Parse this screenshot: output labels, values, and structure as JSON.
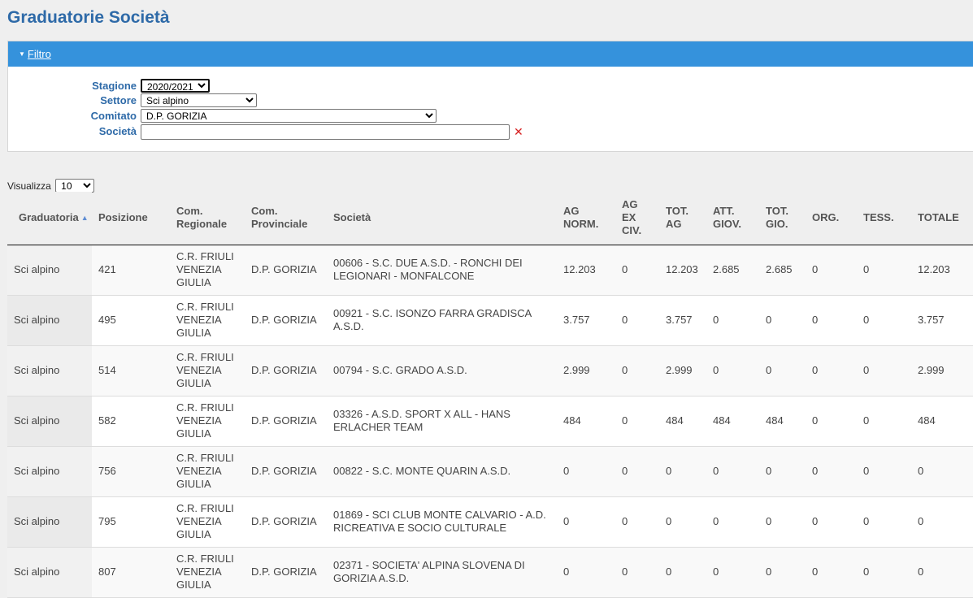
{
  "page": {
    "title": "Graduatorie Società"
  },
  "filter": {
    "toggle_label": "Filtro",
    "season": {
      "label": "Stagione",
      "value": "2020/2021"
    },
    "sector": {
      "label": "Settore",
      "value": "Sci alpino"
    },
    "committee": {
      "label": "Comitato",
      "value": "D.P. GORIZIA"
    },
    "society": {
      "label": "Società",
      "value": ""
    }
  },
  "show": {
    "label": "Visualizza",
    "value": "10"
  },
  "table": {
    "sort_column": "Graduatoria",
    "sort_direction": "asc",
    "headers": [
      [
        "Graduatoria"
      ],
      [
        "Posizione"
      ],
      [
        "Com.",
        "Regionale"
      ],
      [
        "Com.",
        "Provinciale"
      ],
      [
        "Società"
      ],
      [
        "AG",
        "NORM."
      ],
      [
        "AG",
        "EX",
        "CIV."
      ],
      [
        "TOT.",
        "AG"
      ],
      [
        "ATT.",
        "GIOV."
      ],
      [
        "TOT.",
        "GIO."
      ],
      [
        "ORG."
      ],
      [
        "TESS."
      ],
      [
        "TOTALE"
      ]
    ],
    "rows": [
      [
        "Sci alpino",
        "421",
        "C.R. FRIULI VENEZIA GIULIA",
        "D.P. GORIZIA",
        "00606 - S.C. DUE A.S.D. - RONCHI DEI LEGIONARI - MONFALCONE",
        "12.203",
        "0",
        "12.203",
        "2.685",
        "2.685",
        "0",
        "0",
        "12.203"
      ],
      [
        "Sci alpino",
        "495",
        "C.R. FRIULI VENEZIA GIULIA",
        "D.P. GORIZIA",
        "00921 - S.C. ISONZO FARRA GRADISCA A.S.D.",
        "3.757",
        "0",
        "3.757",
        "0",
        "0",
        "0",
        "0",
        "3.757"
      ],
      [
        "Sci alpino",
        "514",
        "C.R. FRIULI VENEZIA GIULIA",
        "D.P. GORIZIA",
        "00794 - S.C. GRADO A.S.D.",
        "2.999",
        "0",
        "2.999",
        "0",
        "0",
        "0",
        "0",
        "2.999"
      ],
      [
        "Sci alpino",
        "582",
        "C.R. FRIULI VENEZIA GIULIA",
        "D.P. GORIZIA",
        "03326 - A.S.D. SPORT X ALL - HANS ERLACHER TEAM",
        "484",
        "0",
        "484",
        "484",
        "484",
        "0",
        "0",
        "484"
      ],
      [
        "Sci alpino",
        "756",
        "C.R. FRIULI VENEZIA GIULIA",
        "D.P. GORIZIA",
        "00822 - S.C. MONTE QUARIN A.S.D.",
        "0",
        "0",
        "0",
        "0",
        "0",
        "0",
        "0",
        "0"
      ],
      [
        "Sci alpino",
        "795",
        "C.R. FRIULI VENEZIA GIULIA",
        "D.P. GORIZIA",
        "01869 - SCI CLUB MONTE CALVARIO - A.D. RICREATIVA E SOCIO CULTURALE",
        "0",
        "0",
        "0",
        "0",
        "0",
        "0",
        "0",
        "0"
      ],
      [
        "Sci alpino",
        "807",
        "C.R. FRIULI VENEZIA GIULIA",
        "D.P. GORIZIA",
        "02371 - SOCIETA' ALPINA SLOVENA DI GORIZIA A.S.D.",
        "0",
        "0",
        "0",
        "0",
        "0",
        "0",
        "0",
        "0"
      ]
    ]
  },
  "colors": {
    "title": "#2e6aa8",
    "filter_bar": "#3592dc",
    "clear_icon": "#d62020"
  }
}
